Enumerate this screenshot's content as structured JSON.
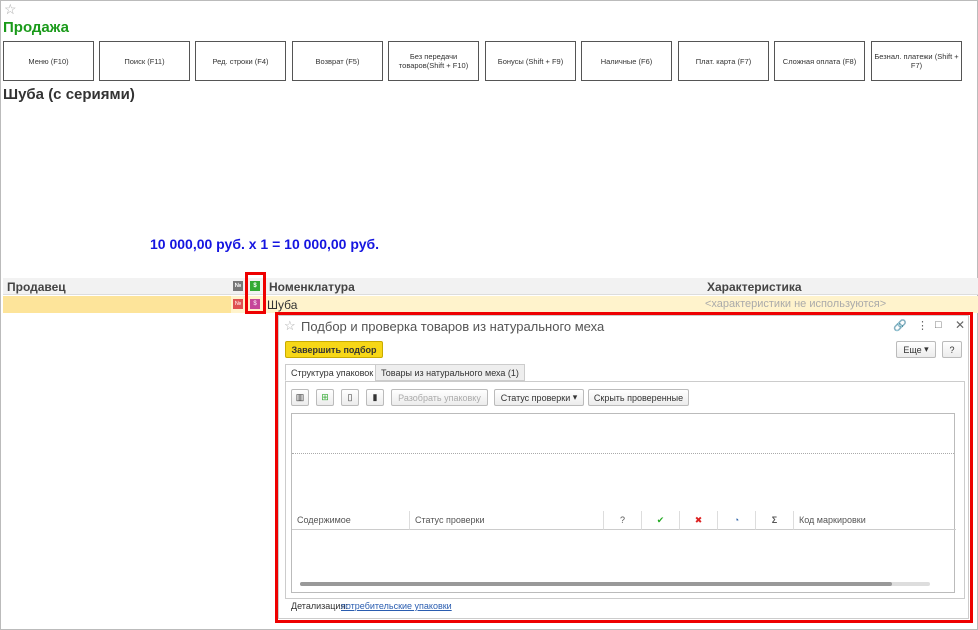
{
  "page": {
    "title": "Продажа",
    "subtitle": "Шуба (с сериями)",
    "price_line": "10 000,00 руб. x 1  = 10 000,00 руб."
  },
  "buttons": [
    "Меню (F10)",
    "Поиск (F11)",
    "Ред. строки (F4)",
    "Возврат (F5)",
    "Без передачи товаров(Shift + F10)",
    "Бонусы (Shift + F9)",
    "Наличные (F6)",
    "Плат. карта (F7)",
    "Сложная оплата (F8)",
    "Безнал. платежи (Shift + F7)"
  ],
  "table": {
    "headers": {
      "seller": "Продавец",
      "nomenclature": "Номенклатура",
      "characteristic": "Характеристика"
    },
    "num_icon": "№",
    "row": {
      "seller": "",
      "nomenclature": "Шуба",
      "characteristic": "<характеристики не используются>"
    }
  },
  "dialog": {
    "title": "Подбор и проверка товаров из натурального меха",
    "finish": "Завершить подбор",
    "more": "Еще",
    "help": "?",
    "tabs": [
      "Структура упаковок",
      "Товары из натурального меха (1)"
    ],
    "toolbar": {
      "unpack": "Разобрать упаковку",
      "status": "Статус проверки",
      "hide": "Скрыть проверенные"
    },
    "columns": [
      "Содержимое",
      "Статус проверки",
      "?",
      "✔",
      "✖",
      "◔",
      "Σ",
      "Код маркировки"
    ],
    "footer_label": "Детализация:",
    "footer_link": "потребительские упаковки"
  },
  "colors": {
    "title": "#1a9a1a",
    "price": "#1515e0",
    "highlight": "#e00000",
    "finish": "#f7d717"
  }
}
